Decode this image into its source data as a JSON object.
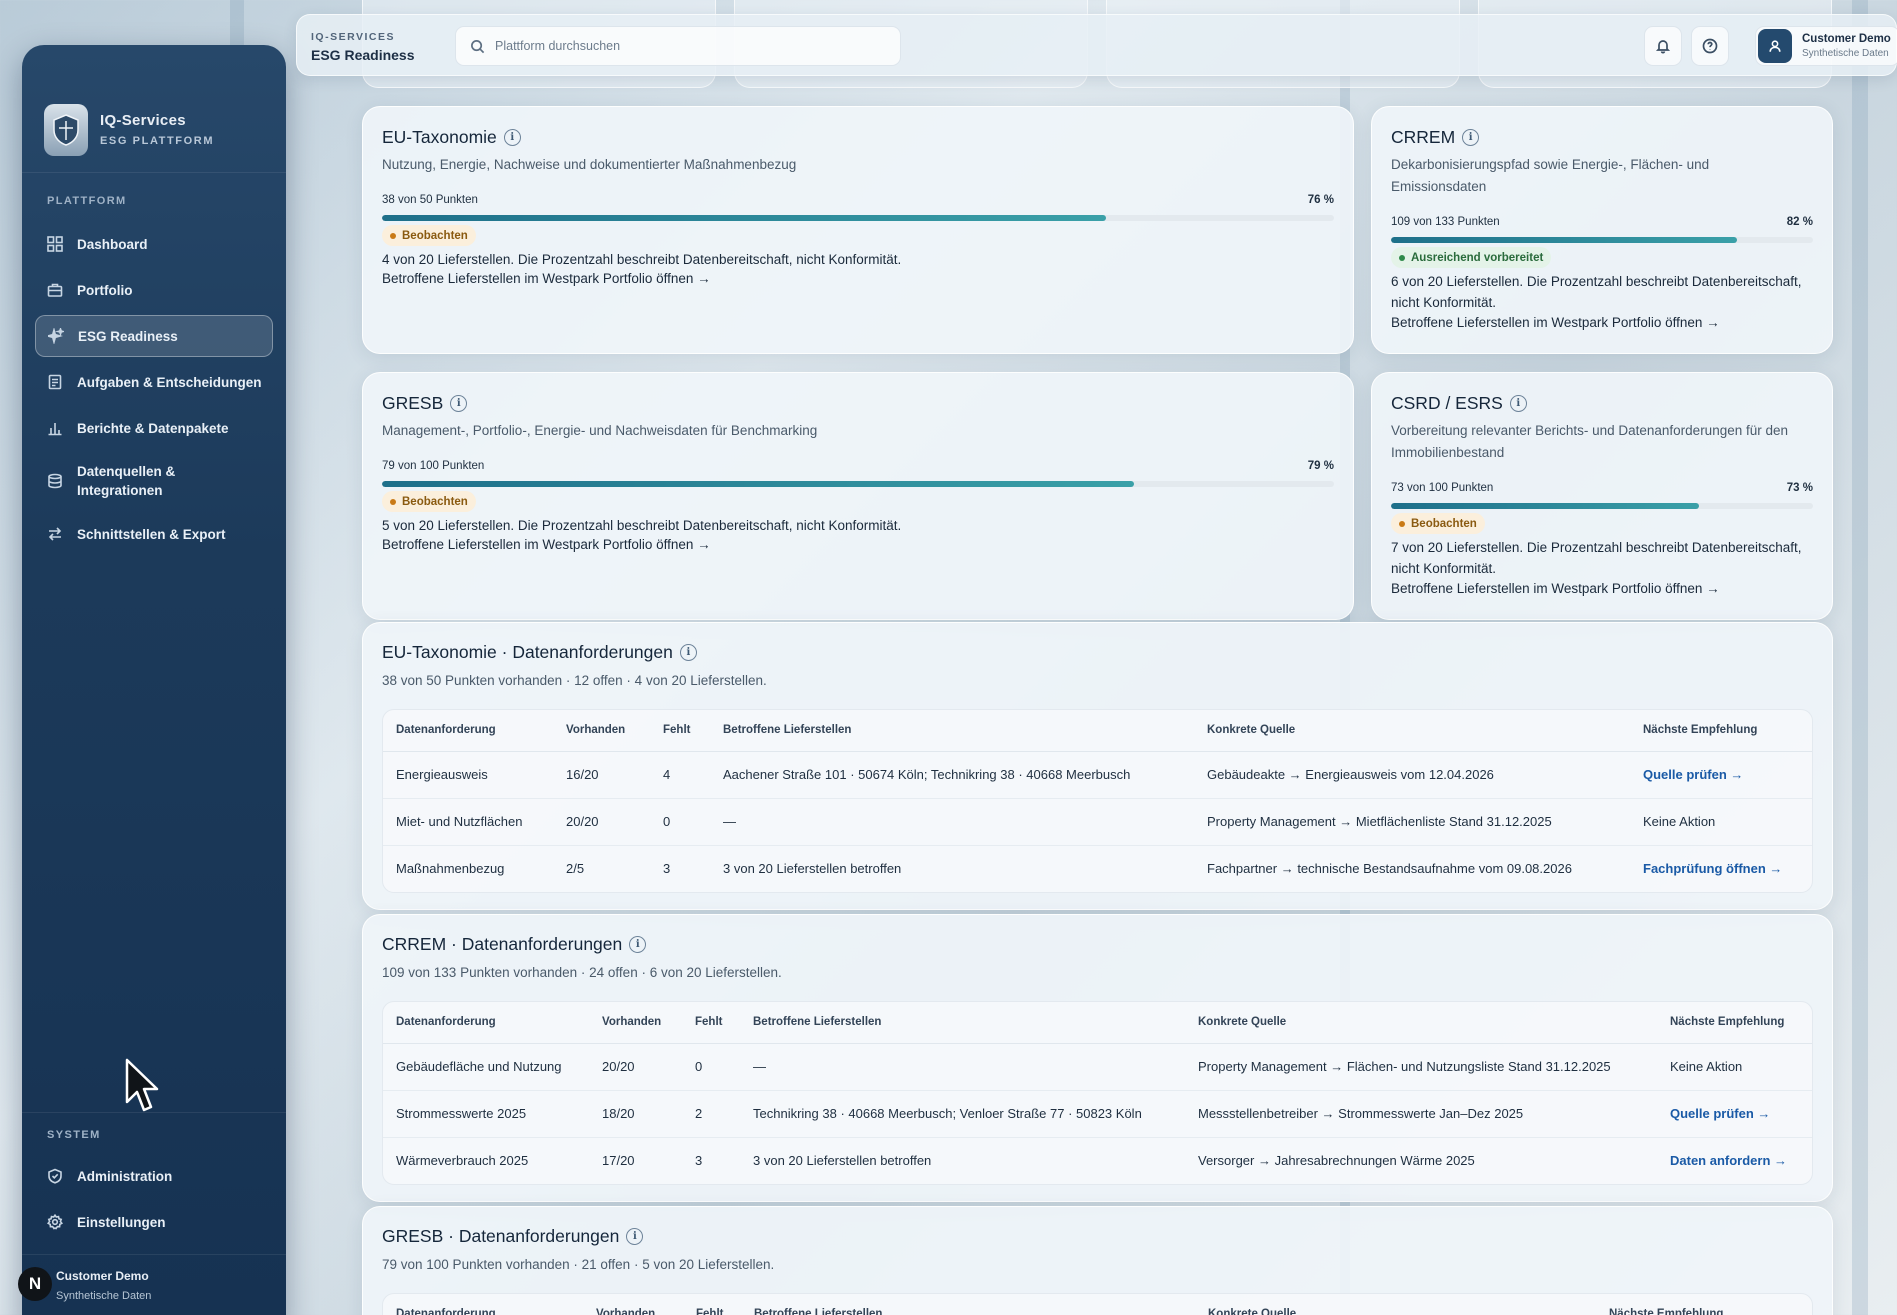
{
  "sidebar": {
    "brand_title": "IQ-Services",
    "brand_subtitle": "ESG PLATTFORM",
    "section_platform": "PLATTFORM",
    "items": [
      {
        "label": "Dashboard",
        "icon": "grid-icon"
      },
      {
        "label": "Portfolio",
        "icon": "briefcase-icon"
      },
      {
        "label": "ESG Readiness",
        "icon": "sparkle-icon",
        "active": true
      },
      {
        "label": "Aufgaben & Entscheidungen",
        "icon": "clipboard-icon"
      },
      {
        "label": "Berichte & Datenpakete",
        "icon": "bar-chart-icon"
      },
      {
        "label": "Datenquellen & Integrationen",
        "icon": "database-icon"
      },
      {
        "label": "Schnittstellen & Export",
        "icon": "arrows-icon"
      }
    ],
    "section_system": "SYSTEM",
    "system_items": [
      {
        "label": "Administration",
        "icon": "shield-icon"
      },
      {
        "label": "Einstellungen",
        "icon": "gear-icon"
      }
    ],
    "user_name": "Customer Demo",
    "user_sub": "Synthetische Daten",
    "avatar_letter": "N"
  },
  "topbar": {
    "kicker": "IQ-SERVICES",
    "title": "ESG Readiness",
    "search_placeholder": "Plattform durchsuchen",
    "account_name": "Customer Demo",
    "account_sub": "Synthetische Daten"
  },
  "colors": {
    "sidebar": "#1c3a5a",
    "progress": "#2a8a9a",
    "link": "#1a5aa6",
    "warn": "#c97a16",
    "ok": "#2f8a4a"
  },
  "cards": [
    {
      "title": "EU-Taxonomie",
      "desc": "Nutzung, Energie, Nachweise und dokumentierter Maßnahmenbezug",
      "points": "38 von 50 Punkten",
      "percent_label": "76 %",
      "percent": 76,
      "badge": "Beobachten",
      "body": "4 von 20 Lieferstellen. Die Prozentzahl beschreibt Datenbereitschaft, nicht Konformität.",
      "link": "Betroffene Lieferstellen im Westpark Portfolio öffnen →"
    },
    {
      "title": "CRREM",
      "desc": "Dekarbonisierungspfad sowie Energie-, Flächen- und Emissionsdaten",
      "points": "109 von 133 Punkten",
      "percent_label": "82 %",
      "percent": 82,
      "badge": "Ausreichend vorbereitet",
      "body": "6 von 20 Lieferstellen. Die Prozentzahl beschreibt Datenbereitschaft, nicht Konformität.",
      "link": "Betroffene Lieferstellen im Westpark Portfolio öffnen →"
    },
    {
      "title": "GRESB",
      "desc": "Management-, Portfolio-, Energie- und Nachweisdaten für Benchmarking",
      "points": "79 von 100 Punkten",
      "percent_label": "79 %",
      "percent": 79,
      "badge": "Beobachten",
      "body": "5 von 20 Lieferstellen. Die Prozentzahl beschreibt Datenbereitschaft, nicht Konformität.",
      "link": "Betroffene Lieferstellen im Westpark Portfolio öffnen →"
    },
    {
      "title": "CSRD / ESRS",
      "desc": "Vorbereitung relevanter Berichts- und Datenanforderungen für den Immobilienbestand",
      "points": "73 von 100 Punkten",
      "percent_label": "73 %",
      "percent": 73,
      "badge": "Beobachten",
      "body": "7 von 20 Lieferstellen. Die Prozentzahl beschreibt Datenbereitschaft, nicht Konformität.",
      "link": "Betroffene Lieferstellen im Westpark Portfolio öffnen →"
    }
  ],
  "tables": [
    {
      "title": "EU-Taxonomie · Datenanforderungen",
      "summary": "38 von 50 Punkten vorhanden · 12 offen · 4 von 20 Lieferstellen.",
      "headers": [
        "Datenanforderung",
        "Vorhanden",
        "Fehlt",
        "Betroffene Lieferstellen",
        "Konkrete Quelle",
        "Nächste Empfehlung"
      ],
      "rows": [
        [
          "Energieausweis",
          "16/20",
          "4",
          "Aachener Straße 101 · 50674 Köln; Technikring 38 · 40668 Meerbusch",
          "Gebäudeakte → Energieausweis vom 12.04.2026",
          "Quelle prüfen →"
        ],
        [
          "Miet- und Nutzflächen",
          "20/20",
          "0",
          "—",
          "Property Management → Mietflächenliste Stand 31.12.2025",
          "Keine Aktion"
        ],
        [
          "Maßnahmenbezug",
          "2/5",
          "3",
          "3 von 20 Lieferstellen betroffen",
          "Fachpartner → technische Bestandsaufnahme vom 09.08.2026",
          "Fachprüfung öffnen →"
        ]
      ]
    },
    {
      "title": "CRREM · Datenanforderungen",
      "summary": "109 von 133 Punkten vorhanden · 24 offen · 6 von 20 Lieferstellen.",
      "headers": [
        "Datenanforderung",
        "Vorhanden",
        "Fehlt",
        "Betroffene Lieferstellen",
        "Konkrete Quelle",
        "Nächste Empfehlung"
      ],
      "rows": [
        [
          "Gebäudefläche und Nutzung",
          "20/20",
          "0",
          "—",
          "Property Management → Flächen- und Nutzungsliste Stand 31.12.2025",
          "Keine Aktion"
        ],
        [
          "Strommesswerte 2025",
          "18/20",
          "2",
          "Technikring 38 · 40668 Meerbusch; Venloer Straße 77 · 50823 Köln",
          "Messstellenbetreiber → Strommesswerte Jan–Dez 2025",
          "Quelle prüfen →"
        ],
        [
          "Wärmeverbrauch 2025",
          "17/20",
          "3",
          "3 von 20 Lieferstellen betroffen",
          "Versorger → Jahresabrechnungen Wärme 2025",
          "Daten anfordern →"
        ]
      ]
    },
    {
      "title": "GRESB · Datenanforderungen",
      "summary": "79 von 100 Punkten vorhanden · 21 offen · 5 von 20 Lieferstellen.",
      "headers": [
        "Datenanforderung",
        "Vorhanden",
        "Fehlt",
        "Betroffene Lieferstellen",
        "Konkrete Quelle",
        "Nächste Empfehlung"
      ],
      "rows": []
    }
  ]
}
